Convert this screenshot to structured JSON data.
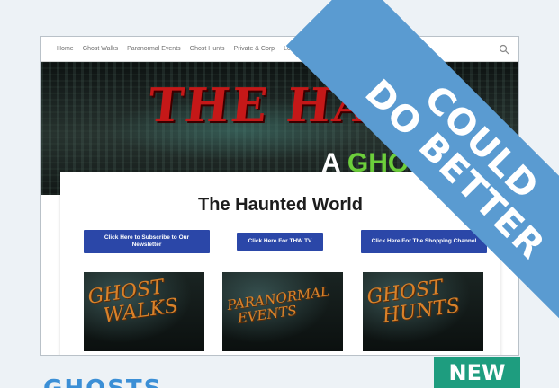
{
  "nav": {
    "items": [
      "Home",
      "Ghost Walks",
      "Paranormal Events",
      "Ghost Hunts",
      "Private & Corp",
      "Locations"
    ]
  },
  "banner": {
    "title": "THE HAUN",
    "subtitle_a": "A ",
    "subtitle_b": "GHOS"
  },
  "page": {
    "heading": "The Haunted World",
    "buttons": [
      "Click Here to Subscribe to Our Newsletter",
      "Click Here For THW TV",
      "Click Here For The Shopping Channel"
    ],
    "thumbs": [
      {
        "text": "GHOST\n  WALKS",
        "icon": "ghost-walks-image"
      },
      {
        "text": "PARANORMAL\n  EVENTS",
        "icon": "paranormal-events-image"
      },
      {
        "text": "GHOST\n  HUNTS",
        "icon": "ghost-hunts-image"
      }
    ]
  },
  "ribbon": {
    "line1": "COULD",
    "line2": "DO BETTER"
  },
  "badge": {
    "label": "NEW"
  },
  "bottom": {
    "title": "GHOSTS"
  },
  "colors": {
    "ribbon": "#5a9bd1",
    "badge": "#1e9d7f",
    "button": "#2b47a8",
    "banner_title": "#c51818",
    "bottom_title": "#3b8fd6"
  }
}
